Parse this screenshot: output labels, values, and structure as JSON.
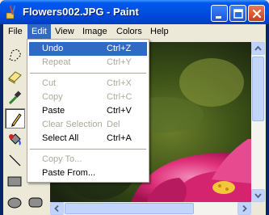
{
  "window": {
    "title": "Flowers002.JPG - Paint"
  },
  "title_buttons": [
    "minimize-icon",
    "maximize-icon",
    "close-icon"
  ],
  "menubar": {
    "items": [
      {
        "label": "File"
      },
      {
        "label": "Edit"
      },
      {
        "label": "View"
      },
      {
        "label": "Image"
      },
      {
        "label": "Colors"
      },
      {
        "label": "Help"
      }
    ],
    "active": "Edit"
  },
  "edit_menu": {
    "items": [
      {
        "label": "Undo",
        "shortcut": "Ctrl+Z",
        "enabled": true,
        "highlighted": true
      },
      {
        "label": "Repeat",
        "shortcut": "Ctrl+Y",
        "enabled": false
      },
      {
        "label": "Cut",
        "shortcut": "Ctrl+X",
        "enabled": false
      },
      {
        "label": "Copy",
        "shortcut": "Ctrl+C",
        "enabled": false
      },
      {
        "label": "Paste",
        "shortcut": "Ctrl+V",
        "enabled": true
      },
      {
        "label": "Clear Selection",
        "shortcut": "Del",
        "enabled": false
      },
      {
        "label": "Select All",
        "shortcut": "Ctrl+A",
        "enabled": true
      },
      {
        "label": "Copy To...",
        "shortcut": "",
        "enabled": false
      },
      {
        "label": "Paste From...",
        "shortcut": "",
        "enabled": true
      }
    ]
  },
  "toolbox": {
    "tools": [
      "free-form-select-icon",
      "eraser-icon",
      "pick-color-icon",
      "pencil-icon",
      "fill-icon",
      "line-icon",
      "rectangle-icon",
      "ellipse-icon",
      "rounded-rectangle-icon"
    ],
    "selected": "pencil-icon"
  },
  "colors": {
    "title_bar": "#0054e3",
    "menu_highlight": "#316ac5",
    "disabled_text": "#aca899",
    "flower": "#e0307a"
  }
}
